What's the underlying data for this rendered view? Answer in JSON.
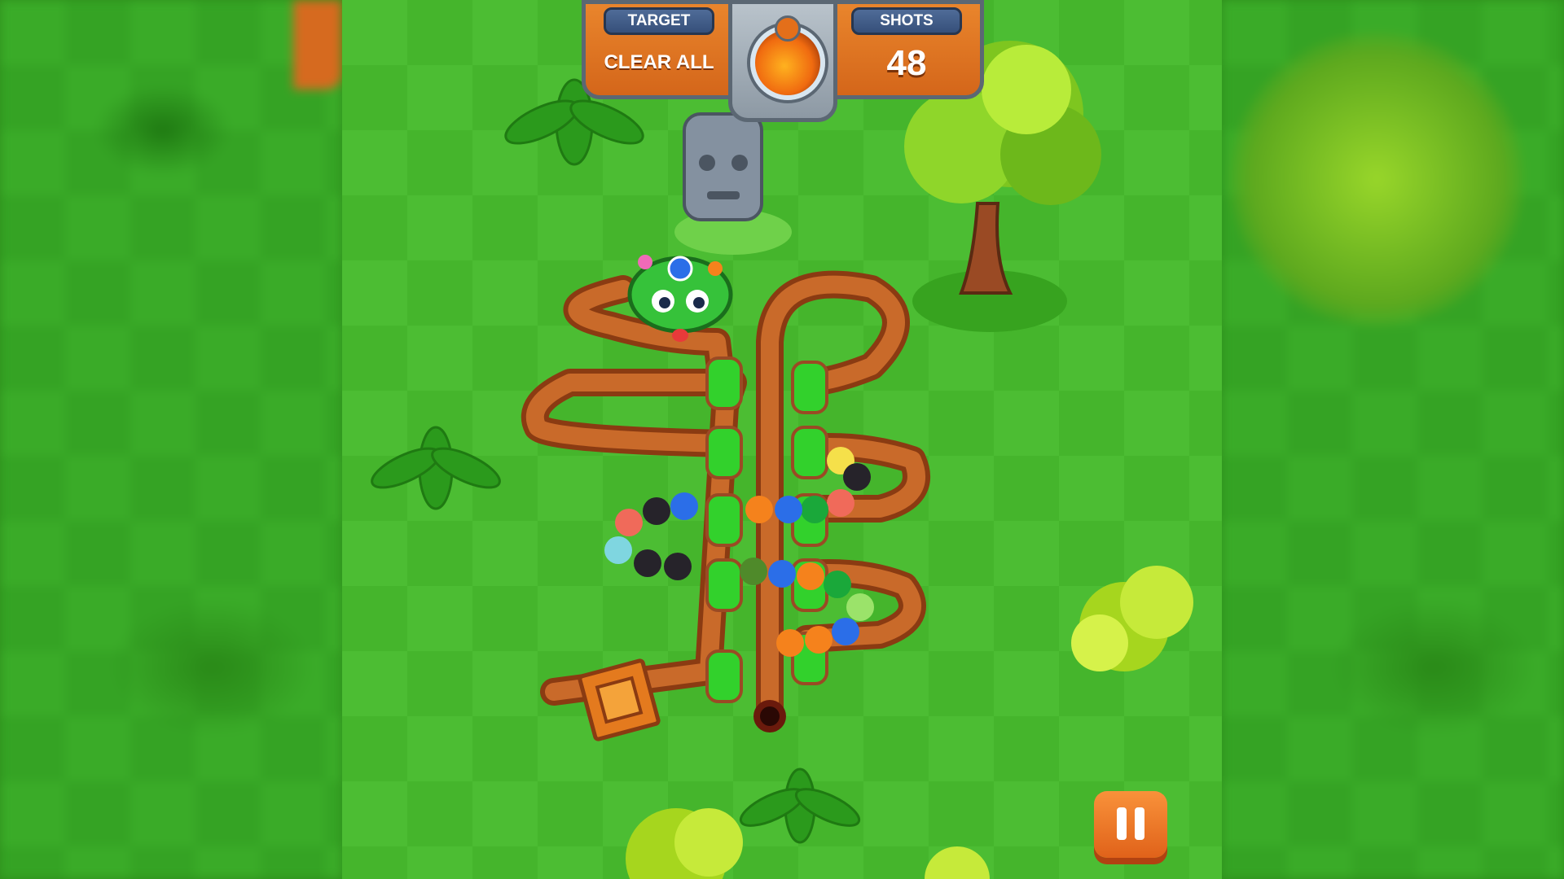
{
  "hud": {
    "target_label": "TARGET",
    "target_value": "CLEAR ALL",
    "shots_label": "SHOTS",
    "shots_value": "48",
    "center_icon": "potion-icon"
  },
  "controls": {
    "pause_icon": "pause-icon"
  },
  "colors": {
    "grass_light": "#4cbd33",
    "grass_dark": "#45b52c",
    "track": "#c96a2a",
    "hud_orange": "#e9852c",
    "hud_tag_blue": "#4f6c98"
  }
}
